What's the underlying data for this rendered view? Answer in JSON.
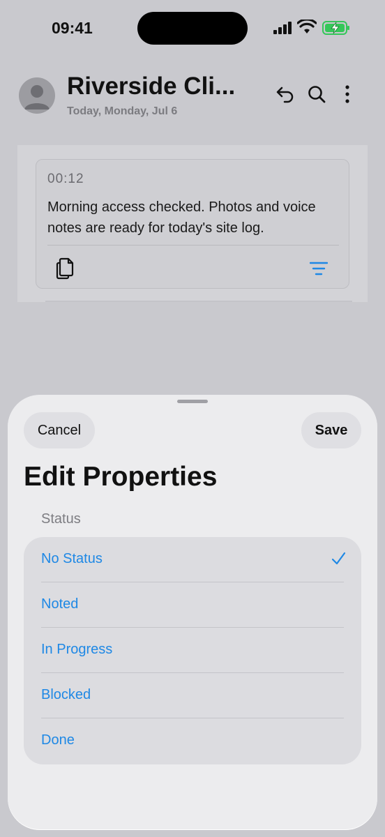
{
  "status_bar": {
    "time": "09:41"
  },
  "header": {
    "title": "Riverside Cli...",
    "subtitle": "Today, Monday, Jul 6"
  },
  "entry": {
    "time": "00:12",
    "text": "Morning access checked. Photos and voice notes are ready for today's site log."
  },
  "sheet": {
    "cancel_label": "Cancel",
    "save_label": "Save",
    "title": "Edit Properties",
    "section_label": "Status",
    "options": [
      {
        "label": "No Status",
        "selected": true
      },
      {
        "label": "Noted",
        "selected": false
      },
      {
        "label": "In Progress",
        "selected": false
      },
      {
        "label": "Blocked",
        "selected": false
      },
      {
        "label": "Done",
        "selected": false
      }
    ]
  },
  "colors": {
    "accent": "#1e88e5",
    "battery": "#34c759"
  }
}
